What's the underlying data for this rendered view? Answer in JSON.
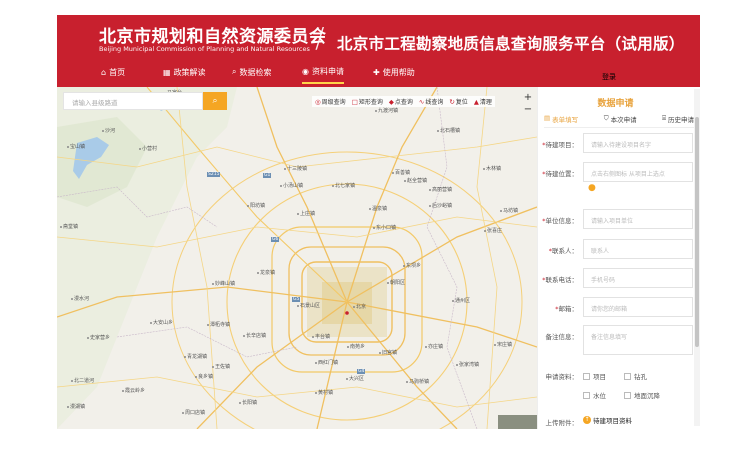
{
  "header": {
    "brand_cn": "北京市规划和自然资源委员会",
    "brand_en": "Beijing Municipal Commission of Planning and Natural Resources",
    "divider": "/",
    "platform_title": "北京市工程勘察地质信息查询服务平台（试用版）",
    "login": "登录",
    "bg_color": "#c8202e"
  },
  "nav": [
    {
      "icon": "home-icon",
      "glyph": "⌂",
      "label": "首页"
    },
    {
      "icon": "grid-icon",
      "glyph": "▦",
      "label": "政策解读"
    },
    {
      "icon": "search-icon",
      "glyph": "⌕",
      "label": "数据检索"
    },
    {
      "icon": "location-icon",
      "glyph": "◉",
      "label": "资料申请",
      "active": true
    },
    {
      "icon": "help-icon",
      "glyph": "✚",
      "label": "使用帮助"
    }
  ],
  "map": {
    "search_placeholder": "请输入县级路道",
    "toolbar": [
      {
        "icon": "circle-query-icon",
        "glyph": "◎",
        "label": "周级查询"
      },
      {
        "icon": "rect-query-icon",
        "glyph": "□",
        "label": "矩形查询"
      },
      {
        "icon": "point-query-icon",
        "glyph": "◆",
        "label": "点查询"
      },
      {
        "icon": "line-query-icon",
        "glyph": "∿",
        "label": "线查询"
      },
      {
        "icon": "reset-icon",
        "glyph": "↻",
        "label": "复位"
      },
      {
        "icon": "clear-icon",
        "glyph": "▲",
        "label": "清理"
      }
    ],
    "zoom_in": "+",
    "zoom_out": "−",
    "places": [
      "马家台",
      "九渡河镇",
      "沙河",
      "宝山镇",
      "小营村",
      "北石槽镇",
      "十三陵镇",
      "百善镇",
      "小汤山镇",
      "北七家镇",
      "温泉镇",
      "阳坊镇",
      "上庄镇",
      "高丽营镇",
      "木林镇",
      "赵全营镇",
      "后沙峪镇",
      "张喜庄",
      "东小口镇",
      "马坊镇",
      "妙峰山镇",
      "龙泉镇",
      "东坝乡",
      "北京",
      "石景山区",
      "朝阳区",
      "通州区",
      "丰台镇",
      "南苑乡",
      "亦庄镇",
      "大兴区",
      "黄村镇",
      "长辛店镇",
      "良乡镇",
      "西红门镇",
      "旧宫镇",
      "马驹桥镇",
      "张家湾镇",
      "宋庄镇",
      "潭柘寺镇",
      "王佐镇",
      "长阳镇",
      "周口店镇",
      "漫水河",
      "大安山乡",
      "史家营乡",
      "斋堂镇",
      "北二道河",
      "青龙湖镇",
      "霞云岭乡",
      "漫湖镇"
    ],
    "road_tags": [
      "G1",
      "S215",
      "G6",
      "G4",
      "G5"
    ]
  },
  "panel": {
    "title": "数据申请",
    "tabs": [
      {
        "icon": "form-icon",
        "glyph": "▤",
        "label": "表单填写",
        "active": true
      },
      {
        "icon": "cart-icon",
        "glyph": "⛉",
        "label": "本次申请"
      },
      {
        "icon": "history-icon",
        "glyph": "⌸",
        "label": "历史申请"
      }
    ],
    "fields": [
      {
        "label": "待建项目：",
        "required": true,
        "placeholder": "请输入待建设项目名字"
      },
      {
        "label": "待建位置：",
        "required": true,
        "placeholder": "点击右侧图标 从项目上选点"
      },
      {
        "label": "单位信息：",
        "required": true,
        "placeholder": "请输入项目单位"
      },
      {
        "label": "联系人：",
        "required": true,
        "placeholder": "联系人"
      },
      {
        "label": "联系电话：",
        "required": true,
        "placeholder": "手机号码"
      },
      {
        "label": "邮箱：",
        "required": true,
        "placeholder": "请你您的邮箱"
      },
      {
        "label": "备注信息：",
        "required": false,
        "placeholder": "备注信息填写"
      }
    ],
    "data_label": "申请资料：",
    "checkboxes": [
      "项目",
      "钻孔",
      "水位",
      "地面沉降"
    ],
    "upload_label": "上传附件：",
    "upload_link": "待建项目资料",
    "accent_color": "#e8a33d"
  }
}
